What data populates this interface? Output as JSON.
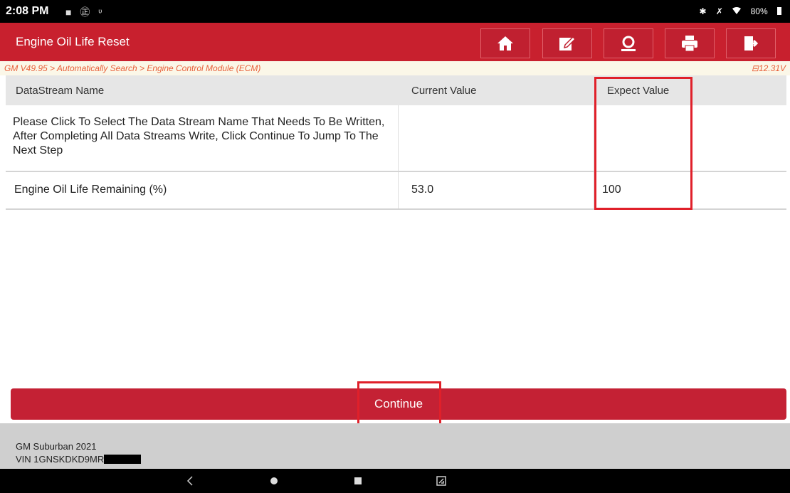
{
  "status_bar": {
    "time": "2:08 PM",
    "left_icons": "■ ㊣ ᶹ",
    "bluetooth": "✱",
    "mute": "✗",
    "battery": "80%"
  },
  "header": {
    "title": "Engine Oil Life Reset",
    "accent_color": "#c8202e",
    "buttons": [
      "home-icon",
      "edit-report-icon",
      "support-icon",
      "print-icon",
      "exit-icon"
    ]
  },
  "breadcrumb": {
    "path": "GM V49.95 > Automatically Search > Engine Control Module (ECM)",
    "voltage": "⊟12.31V"
  },
  "table": {
    "headers": {
      "name": "DataStream Name",
      "current": "Current Value",
      "expect": "Expect Value"
    },
    "rows": [
      {
        "name": "Please Click To Select The Data Stream Name That Needs To Be Written, After Completing All Data Streams Write, Click Continue To Jump To The Next Step",
        "current": "",
        "expect": ""
      },
      {
        "name": "Engine Oil Life Remaining (%)",
        "current": "53.0",
        "expect": "100"
      }
    ]
  },
  "continue_label": "Continue",
  "vehicle": {
    "model": "GM Suburban 2021",
    "vin": "VIN 1GNSKDKD9MR"
  }
}
